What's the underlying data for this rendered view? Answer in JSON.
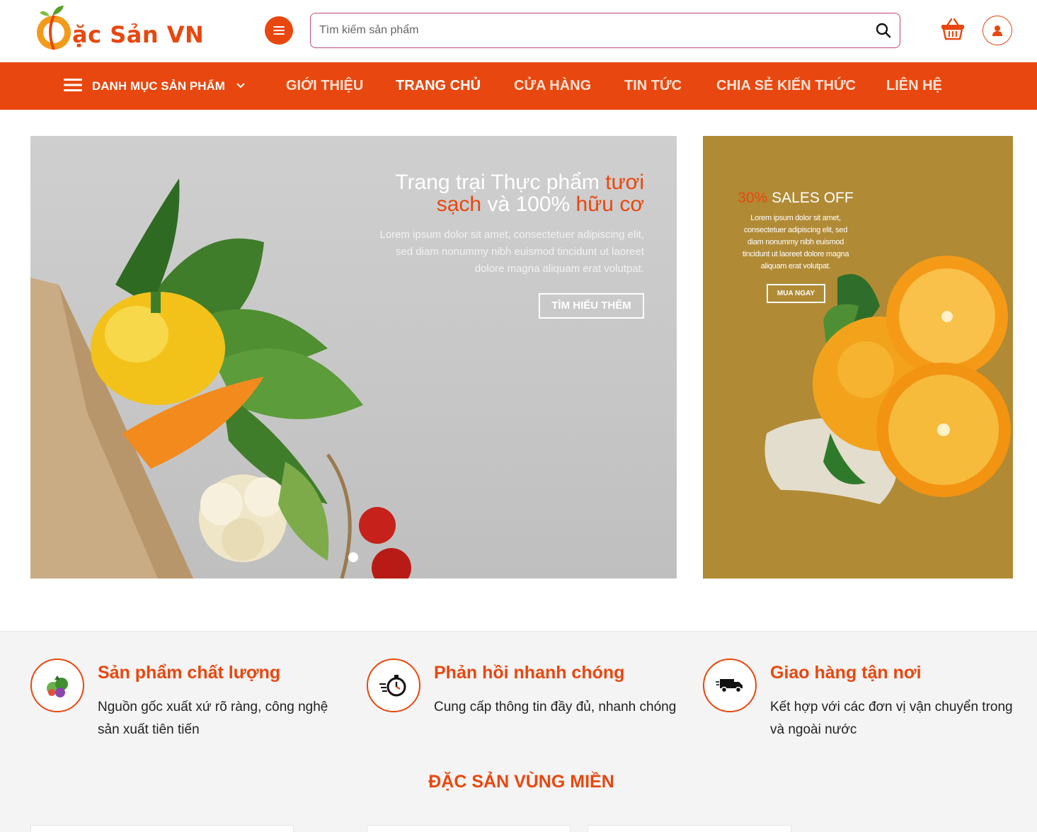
{
  "header": {
    "logo_text": "ặc Sản VN",
    "search_placeholder": "Tìm kiếm sản phẩm",
    "icons": [
      "menu-icon",
      "search-icon",
      "cart-icon",
      "user-icon"
    ]
  },
  "nav": {
    "category_label": "DANH MỤC SẢN PHẨM",
    "items": [
      {
        "label": "GIỚI THIỆU"
      },
      {
        "label": "TRANG CHỦ"
      },
      {
        "label": "CỬA HÀNG"
      },
      {
        "label": "TIN TỨC"
      },
      {
        "label": "CHIA SẺ KIẾN THỨC"
      },
      {
        "label": "LIÊN HỆ"
      }
    ]
  },
  "hero": {
    "title_part1": "Trang trại Thực phẩm ",
    "title_hl1": "tươi sạch",
    "title_part2": " và 100% ",
    "title_hl2": "hữu cơ",
    "description": "Lorem ipsum dolor sit amet, consectetuer adipiscing elit, sed diam nonummy nibh euismod tincidunt ut laoreet dolore magna aliquam erat volutpat.",
    "button_label": "TÌM HIỂU THÊM"
  },
  "promo": {
    "percent": "30%",
    "title_rest": " SALES OFF",
    "description": "Lorem ipsum dolor sit amet, consectetuer adipiscing elit, sed diam nonummy nibh euismod tincidunt ut laoreet dolore magna aliquam erat volutpat.",
    "button_label": "MUA NGAY"
  },
  "features": [
    {
      "title": "Sản phẩm chất lượng",
      "description": "Nguồn gốc xuất xứ rõ ràng, công nghệ sản xuất tiên tiến",
      "icon": "vegetables-icon"
    },
    {
      "title": "Phản hồi nhanh chóng",
      "description": "Cung cấp thông tin đầy đủ, nhanh chóng",
      "icon": "stopwatch-icon"
    },
    {
      "title": "Giao hàng tận nơi",
      "description": "Kết hợp với các đơn vị vận chuyển trong và ngoài nước",
      "icon": "truck-icon"
    }
  ],
  "section": {
    "title": "ĐẶC SẢN VÙNG MIỀN"
  },
  "colors": {
    "accent": "#e8470f",
    "promo_bg": "#b08a35",
    "search_border": "#b8497a"
  }
}
